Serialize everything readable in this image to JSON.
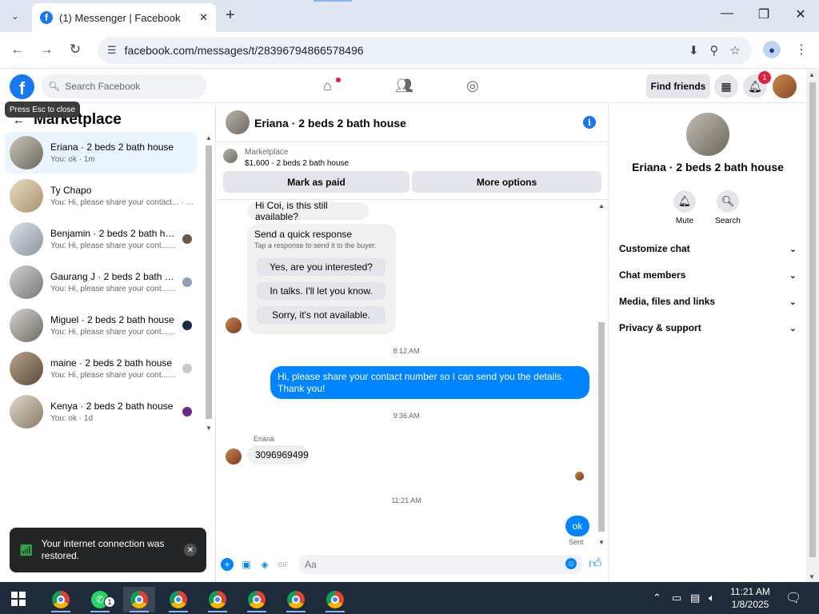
{
  "browser": {
    "tab_title": "(1) Messenger | Facebook",
    "url": "facebook.com/messages/t/28396794866578496",
    "new_tab_symbol": "+",
    "close_symbol": "✕"
  },
  "fb_header": {
    "logo": "f",
    "search_placeholder": "Search Facebook",
    "find_friends": "Find friends",
    "notif_count": "1",
    "tooltip": "Press Esc to close"
  },
  "left": {
    "title": "Marketplace",
    "conversations": [
      {
        "name": "Eriana · 2 beds 2 bath house",
        "preview": "You: ok · 1m"
      },
      {
        "name": "Ty Chapo",
        "preview": "You: Hi, please share your contact... · 1m"
      },
      {
        "name": "Benjamin · 2 beds 2 bath ho...",
        "preview": "You: Hi, please share your cont... · 3h"
      },
      {
        "name": "Gaurang J · 2 beds 2 bath ho...",
        "preview": "You: Hi, please share your cont... · 3h"
      },
      {
        "name": "Miguel · 2 beds 2 bath house",
        "preview": "You: Hi, please share your cont... · 3h"
      },
      {
        "name": "maine · 2 beds 2 bath house",
        "preview": "You: Hi, please share your cont... · 3h"
      },
      {
        "name": "Kenya · 2 beds 2 bath house",
        "preview": "You: ok · 1d"
      }
    ]
  },
  "toast": {
    "message": "Your internet connection was restored.",
    "close": "✕"
  },
  "chat": {
    "title": "Eriana · 2 beds 2 bath house",
    "marketplace_label": "Marketplace",
    "listing": "$1,600 - 2 beds 2 bath house",
    "mark_paid": "Mark as paid",
    "more_options": "More options",
    "msg_still_available": "Hi Coi, is this still available?",
    "quick_title": "Send a quick response",
    "quick_sub": "Tap a response to send it to the buyer.",
    "quick_options": [
      "Yes, are you interested?",
      "In talks. I'll let you know.",
      "Sorry, it's not available."
    ],
    "time1": "8:12 AM",
    "msg_out": "Hi, please share your contact number so I can send you the details. Thank you!",
    "time2": "9:36 AM",
    "sender": "Eriana",
    "msg_phone": "3096969499",
    "time3": "11:21 AM",
    "msg_ok": "ok",
    "sent_label": "Sent",
    "composer_placeholder": "Aa"
  },
  "right": {
    "name": "Eriana · 2 beds 2 bath house",
    "mute": "Mute",
    "search": "Search",
    "sections": [
      "Customize chat",
      "Chat members",
      "Media, files and links",
      "Privacy & support"
    ]
  },
  "taskbar": {
    "wa_badge": "1",
    "time": "11:21 AM",
    "date": "1/8/2025"
  },
  "colors": {
    "fb_blue": "#1877f2",
    "messenger_blue": "#0084ff",
    "active_conv": "#ebf5ff",
    "taskbar": "#1f2a3a"
  }
}
